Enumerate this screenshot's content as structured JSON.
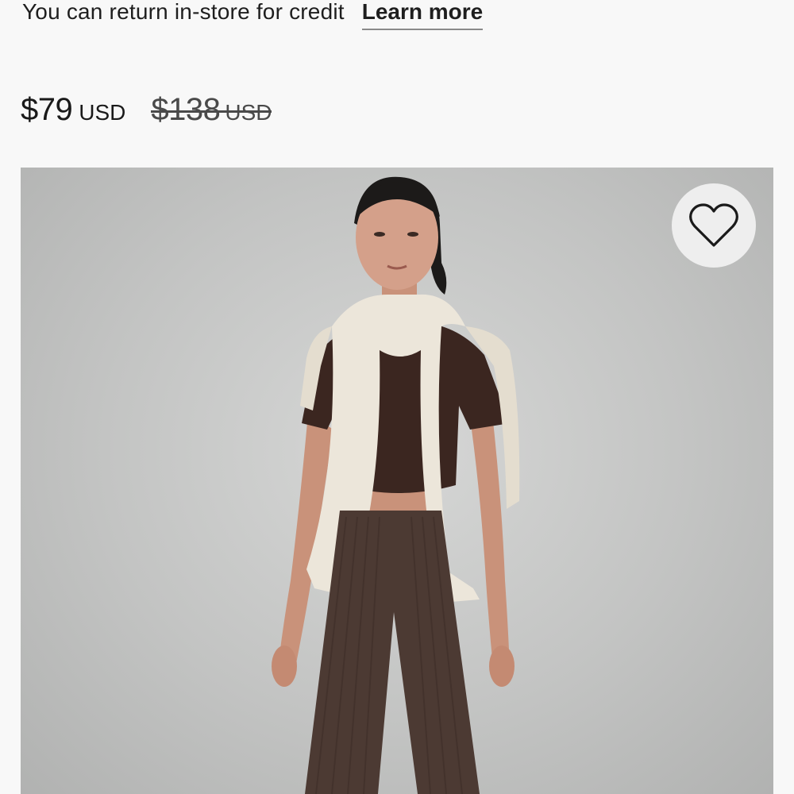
{
  "return_note": {
    "text": "You can return in-store for credit",
    "link_label": "Learn more"
  },
  "price": {
    "current_amount": "$79",
    "current_currency": "USD",
    "original_amount": "$138",
    "original_currency": "USD"
  },
  "product_image": {
    "alt": "Model wearing dark brown cropped tee and ribbed flared pants with cream sweater over shoulders"
  },
  "wishlist": {
    "icon": "heart-icon"
  },
  "colors": {
    "text": "#1a1a1a",
    "underline": "#8a8a8a",
    "strike_price": "#4a4a4a",
    "photo_background": "#c3c4c3",
    "wishlist_button": "#eeeeee"
  }
}
